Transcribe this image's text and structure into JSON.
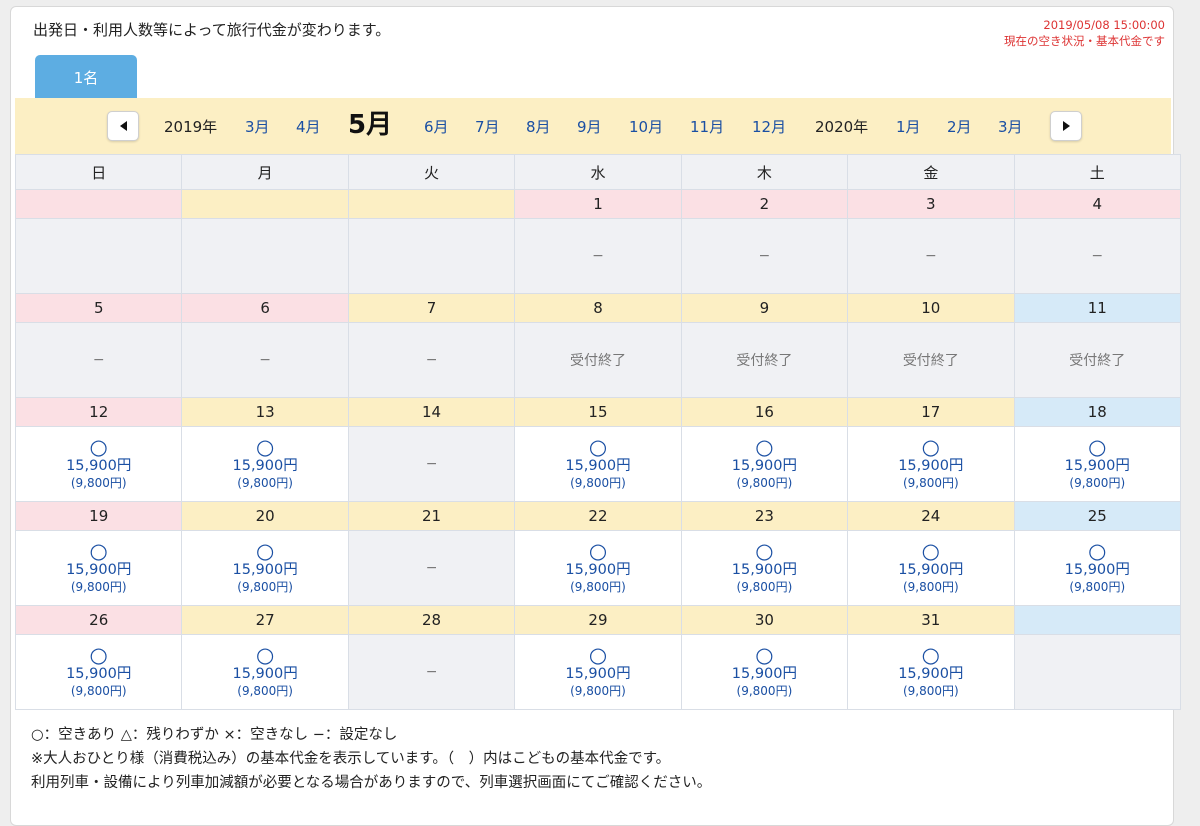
{
  "header": {
    "notice": "出発日・利用人数等によって旅行代金が変わります。",
    "timestamp": "2019/05/08 15:00:00",
    "timestamp_note": "現在の空き状況・基本代金です"
  },
  "tabs": [
    {
      "label": "1名",
      "active": true
    }
  ],
  "month_nav": {
    "prev_icon": "triangle-left-icon",
    "next_icon": "triangle-right-icon",
    "year_2019": "2019年",
    "year_2020": "2020年",
    "months": [
      "3月",
      "4月",
      "5月",
      "6月",
      "7月",
      "8月",
      "9月",
      "10月",
      "11月",
      "12月",
      "1月",
      "2月",
      "3月"
    ],
    "current": "5月"
  },
  "weekdays": [
    "日",
    "月",
    "火",
    "水",
    "木",
    "金",
    "土"
  ],
  "symbols": {
    "available": "○",
    "none": "−",
    "closed": "受付終了"
  },
  "prices": {
    "adult": "15,900円",
    "child": "(9,800円)"
  },
  "weeks": [
    [
      "",
      "",
      "",
      "1",
      "2",
      "3",
      "4"
    ],
    [
      "5",
      "6",
      "7",
      "8",
      "9",
      "10",
      "11"
    ],
    [
      "12",
      "13",
      "14",
      "15",
      "16",
      "17",
      "18"
    ],
    [
      "19",
      "20",
      "21",
      "22",
      "23",
      "24",
      "25"
    ],
    [
      "26",
      "27",
      "28",
      "29",
      "30",
      "31",
      ""
    ]
  ],
  "legend": {
    "line1": "○：空きあり △：残りわずか ×：空きなし −：設定なし",
    "line2": "※大人おひとり様（消費税込み）の基本代金を表示しています。（　）内はこどもの基本代金です。",
    "line3": "利用列車・設備により列車加減額が必要となる場合がありますので、列車選択画面にてご確認ください。"
  },
  "colors": {
    "sunday": "#fbe0e4",
    "weekday": "#fcefc4",
    "saturday": "#d6eaf8",
    "link_blue": "#1a4fa3",
    "tab_blue": "#5dade2",
    "timestamp_red": "#dd3333"
  }
}
